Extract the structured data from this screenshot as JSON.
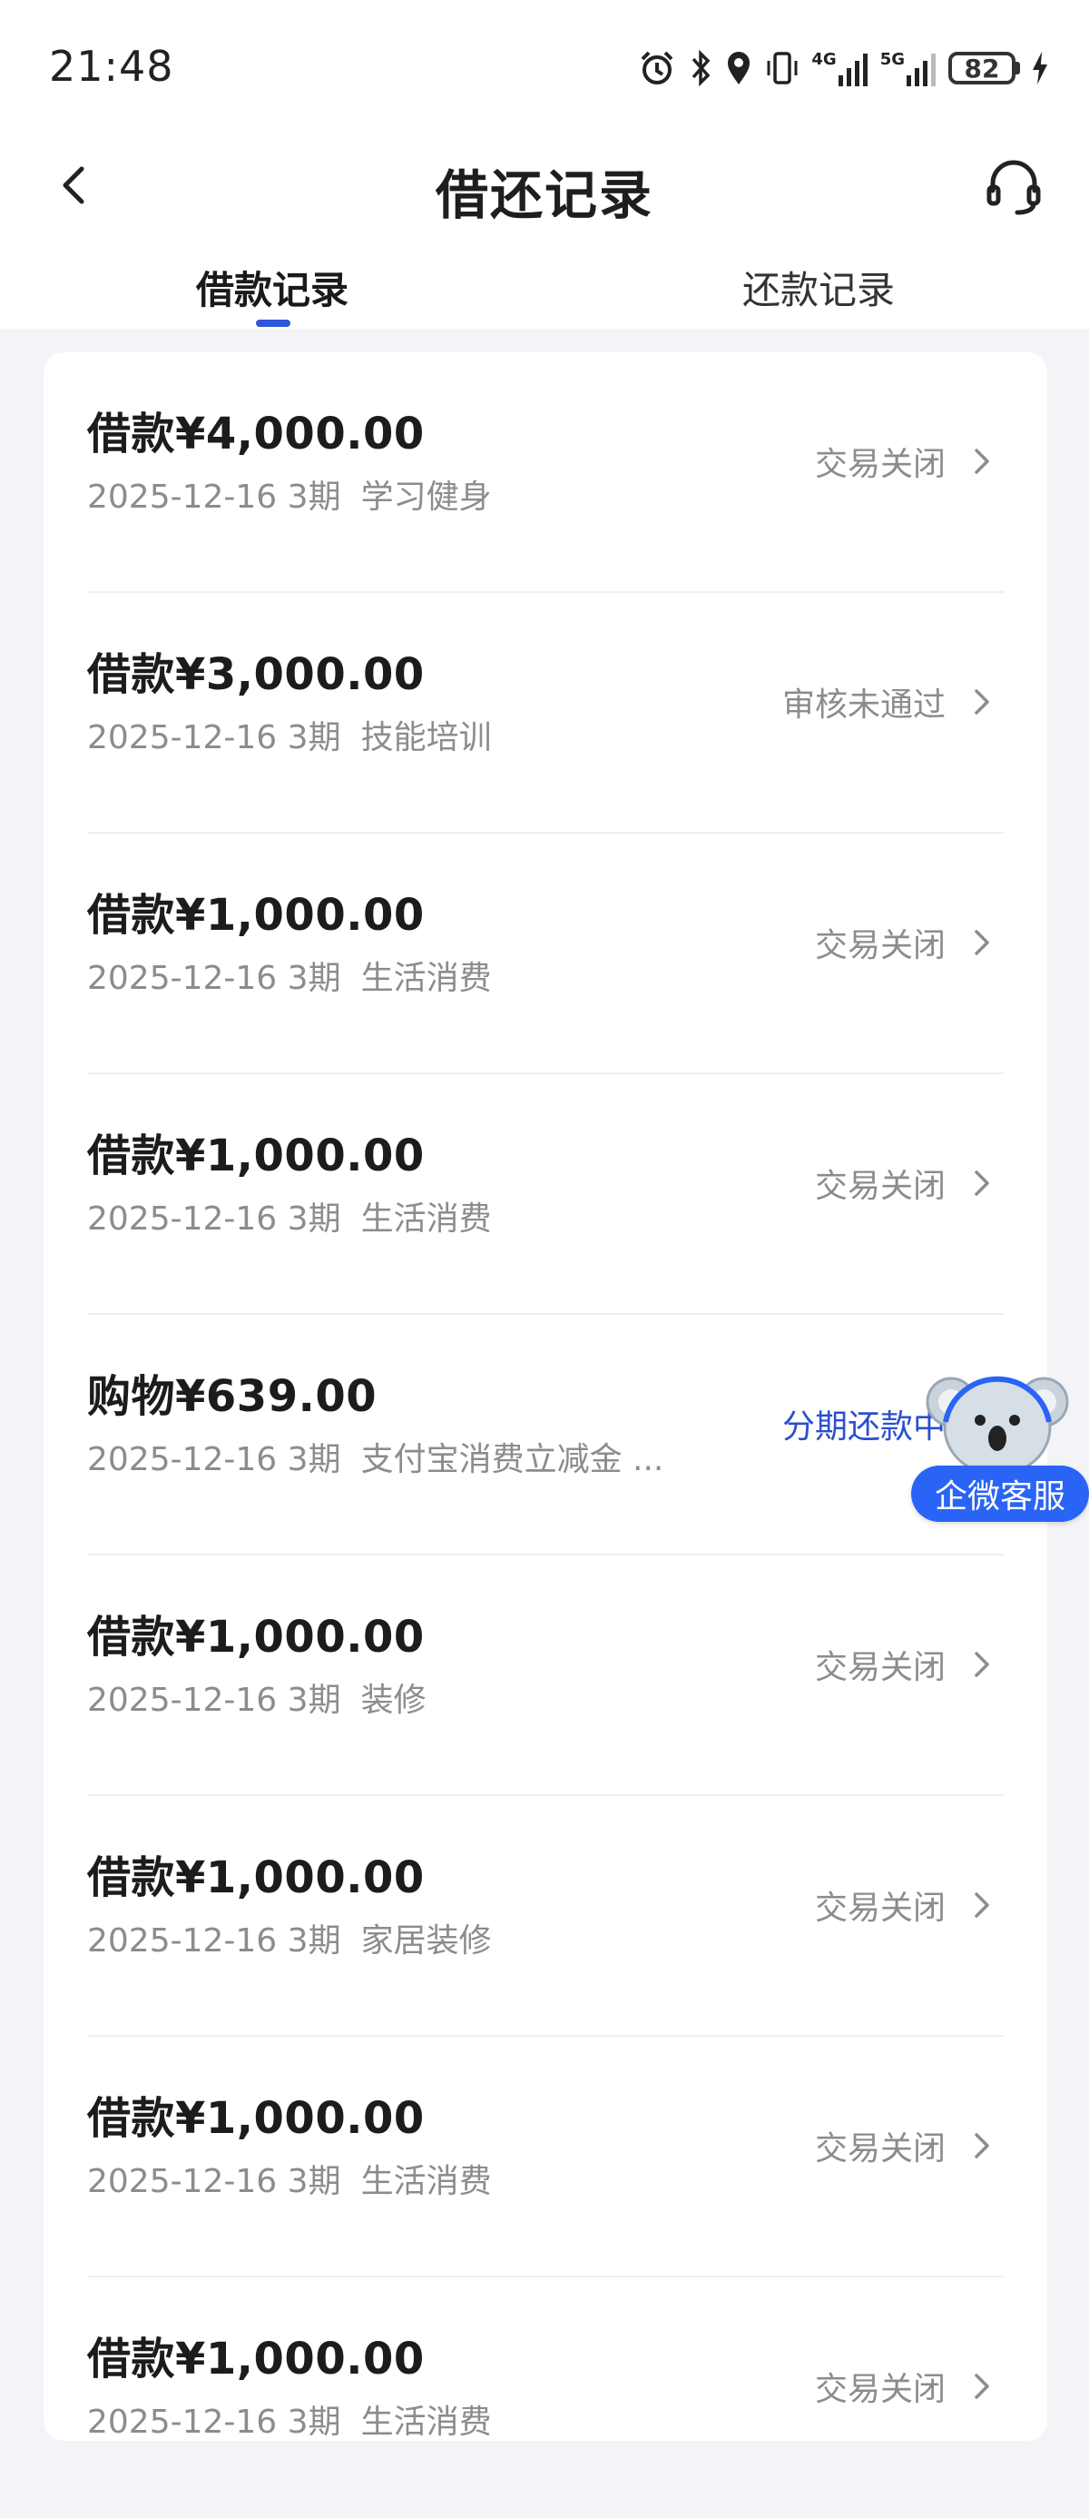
{
  "status_bar": {
    "time": "21:48",
    "signal_1": "4G",
    "signal_2": "5G",
    "battery": "82"
  },
  "header": {
    "title": "借还记录",
    "back_icon": "chevron-left-icon",
    "cs_icon": "headset-icon"
  },
  "tabs": [
    {
      "label": "借款记录",
      "active": true
    },
    {
      "label": "还款记录",
      "active": false
    }
  ],
  "colors": {
    "accent": "#2e56d8",
    "status_gray": "#8c8c8c",
    "status_blue": "#2b4fcf",
    "float_label": "#2a64f6"
  },
  "records": [
    {
      "amount": "借款¥4,000.00",
      "date": "2025-12-16",
      "term": "3期",
      "purpose": "学习健身",
      "status": "交易关闭"
    },
    {
      "amount": "借款¥3,000.00",
      "date": "2025-12-16",
      "term": "3期",
      "purpose": "技能培训",
      "status": "审核未通过"
    },
    {
      "amount": "借款¥1,000.00",
      "date": "2025-12-16",
      "term": "3期",
      "purpose": "生活消费",
      "status": "交易关闭"
    },
    {
      "amount": "借款¥1,000.00",
      "date": "2025-12-16",
      "term": "3期",
      "purpose": "生活消费",
      "status": "交易关闭"
    },
    {
      "amount": "购物¥639.00",
      "date": "2025-12-16",
      "term": "3期",
      "purpose": "支付宝消费立减金 ...",
      "status": "分期还款中"
    },
    {
      "amount": "借款¥1,000.00",
      "date": "2025-12-16",
      "term": "3期",
      "purpose": "装修",
      "status": "交易关闭"
    },
    {
      "amount": "借款¥1,000.00",
      "date": "2025-12-16",
      "term": "3期",
      "purpose": "家居装修",
      "status": "交易关闭"
    },
    {
      "amount": "借款¥1,000.00",
      "date": "2025-12-16",
      "term": "3期",
      "purpose": "生活消费",
      "status": "交易关闭"
    },
    {
      "amount": "借款¥1,000.00",
      "date": "2025-12-16",
      "term": "3期",
      "purpose": "生活消费",
      "status": "交易关闭"
    }
  ],
  "floating_service": {
    "label": "企微客服",
    "icon": "koala-mascot-icon"
  }
}
